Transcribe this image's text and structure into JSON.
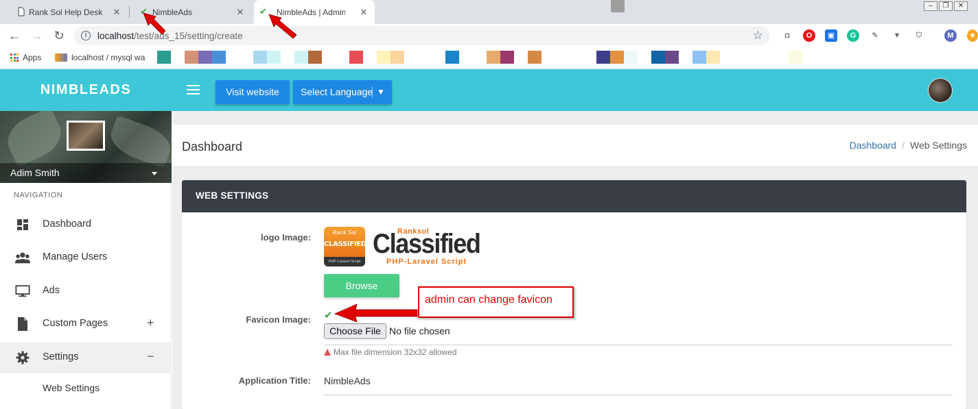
{
  "browser": {
    "tabs": [
      {
        "title": "Rank Sol Help Desk",
        "close": "✕"
      },
      {
        "title": "NimbleAds",
        "close": "✕"
      },
      {
        "title": "NimbleAds | Admin p",
        "close": "✕"
      }
    ],
    "url_host": "localhost",
    "url_path": "/test/ads_15/setting/create",
    "bookmarks": [
      {
        "label": "Apps"
      },
      {
        "label": "localhost / mysql wa"
      }
    ],
    "bookmark_colors": [
      "#2a9d8f",
      "#d4917a",
      "#7a6cb5",
      "#4a90d9",
      "#a8d8f0",
      "#cdf5f5",
      "#cdf5f5",
      "#b06a3b",
      "#e84c54",
      "#fff3b8",
      "#fdd49e",
      "#1a85c8",
      "#e8aa6a",
      "#9a3a6a",
      "#d48a45",
      "#3d3f8a",
      "#e2913e",
      "#eef8f8",
      "#1263a4",
      "#6a4a86",
      "#8dc2f2",
      "#fde9b0",
      "#fbfbdf"
    ],
    "ext_icons": [
      "camera-icon",
      "opera-icon",
      "capture-icon",
      "grammarly-icon",
      "eyedropper-icon",
      "vee-icon",
      "shield-icon"
    ],
    "profile_initial": "M"
  },
  "header": {
    "brand": "NIMBLEADS",
    "visit_btn": "Visit website",
    "lang_btn": "Select Language",
    "lang_caret": "▼"
  },
  "sidebar": {
    "user_name": "Adim Smith",
    "nav_heading": "NAVIGATION",
    "items": [
      {
        "label": "Dashboard",
        "icon": "dashboard-icon"
      },
      {
        "label": "Manage Users",
        "icon": "users-icon"
      },
      {
        "label": "Ads",
        "icon": "monitor-icon"
      },
      {
        "label": "Custom Pages",
        "icon": "file-icon",
        "toggle": "+"
      },
      {
        "label": "Settings",
        "icon": "gear-icon",
        "toggle": "−"
      }
    ],
    "sub_items": [
      {
        "label": "Web Settings"
      }
    ]
  },
  "page": {
    "title": "Dashboard",
    "breadcrumb": {
      "link": "Dashboard",
      "sep": "/",
      "current": "Web Settings"
    }
  },
  "card": {
    "title": "WEB SETTINGS",
    "logo_label": "logo Image:",
    "logo_brand_top": "Ranksol",
    "logo_brand_main": "Classified",
    "logo_brand_sub": "PHP-Laravel Script",
    "logo_badge_top": "Rank Sol",
    "logo_badge_main": "CLASSIFIED",
    "logo_badge_bottom": "PHP-Laravel Script",
    "browse_btn": "Browse",
    "favicon_label": "Favicon Image:",
    "favicon_check": "✔",
    "choose_file_btn": "Choose File",
    "file_status": "No file chosen",
    "hint": "Max file dimension 32x32 allowed",
    "app_title_label": "Application Title:",
    "app_title_value": "NimbleAds"
  },
  "annotation": {
    "callout_text": "admin can change favicon",
    "color": "#e00000"
  }
}
